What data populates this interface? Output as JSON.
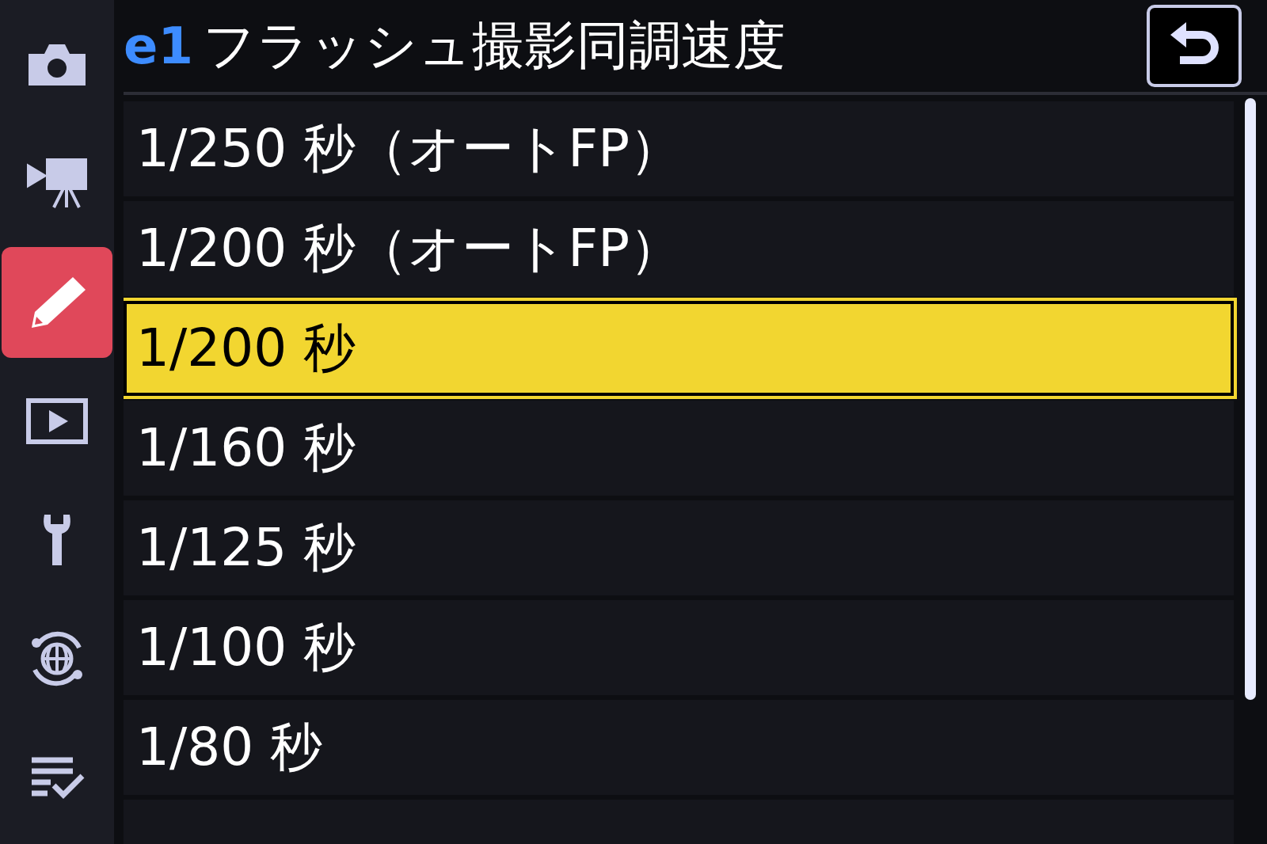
{
  "sidebar": {
    "items": [
      {
        "kind": "camera",
        "selected": false
      },
      {
        "kind": "movie",
        "selected": false
      },
      {
        "kind": "pencil",
        "selected": true
      },
      {
        "kind": "playback",
        "selected": false
      },
      {
        "kind": "wrench",
        "selected": false
      },
      {
        "kind": "network",
        "selected": false
      },
      {
        "kind": "mymenu",
        "selected": false
      }
    ]
  },
  "header": {
    "code": "e1",
    "title": "フラッシュ撮影同調速度"
  },
  "options": [
    {
      "label": "1/250 秒（オートFP）",
      "selected": false
    },
    {
      "label": "1/200 秒（オートFP）",
      "selected": false
    },
    {
      "label": "1/200 秒",
      "selected": true
    },
    {
      "label": "1/160 秒",
      "selected": false
    },
    {
      "label": "1/125 秒",
      "selected": false
    },
    {
      "label": "1/100 秒",
      "selected": false
    },
    {
      "label": "1/80 秒",
      "selected": false
    }
  ]
}
